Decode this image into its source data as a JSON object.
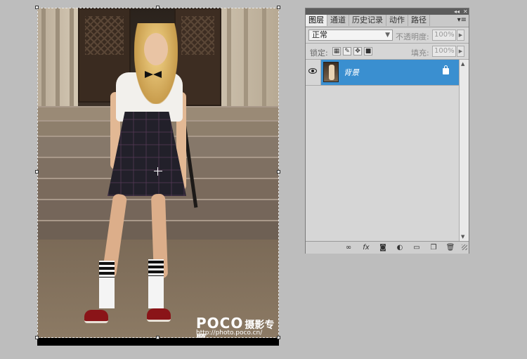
{
  "canvas": {
    "watermark_brand": "POCO",
    "watermark_subtitle": "摄影专题",
    "watermark_url": "http://photo.poco.cn/"
  },
  "layers_panel": {
    "tabs": [
      {
        "label": "图层",
        "active": true
      },
      {
        "label": "通道",
        "active": false
      },
      {
        "label": "历史记录",
        "active": false
      },
      {
        "label": "动作",
        "active": false
      },
      {
        "label": "路径",
        "active": false
      }
    ],
    "menu_icon": "panel-menu-icon",
    "blend_mode": "正常",
    "opacity_label": "不透明度:",
    "opacity_value": "100%",
    "lock_label": "锁定:",
    "fill_label": "填充:",
    "fill_value": "100%",
    "layers": [
      {
        "name": "背景",
        "visible": true,
        "locked": true,
        "selected": true
      }
    ],
    "colors": {
      "selection": "#3a8fd0",
      "panel_bg": "#d6d6d6",
      "workspace_bg": "#bdbdbd"
    }
  }
}
